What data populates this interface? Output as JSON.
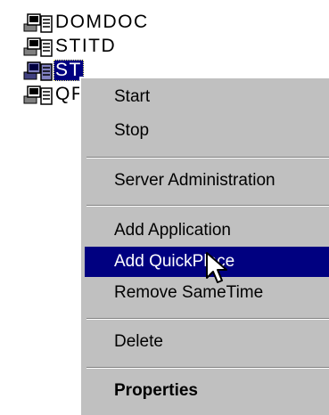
{
  "tree": {
    "items": [
      {
        "label": "DOMDOC",
        "selected": false
      },
      {
        "label": "STITD",
        "selected": false
      },
      {
        "label": "ST",
        "selected": true
      },
      {
        "label": "QF",
        "selected": false
      }
    ],
    "icon": "server-computer-icon"
  },
  "context_menu": {
    "items": {
      "start": {
        "label": "Start",
        "has_submenu": true
      },
      "stop": {
        "label": "Stop",
        "has_submenu": true
      },
      "server_admin": {
        "label": "Server Administration"
      },
      "add_application": {
        "label": "Add Application"
      },
      "add_quickplace": {
        "label": "Add QuickPlace",
        "highlighted": true
      },
      "remove_sametime": {
        "label": "Remove SameTime"
      },
      "delete": {
        "label": "Delete"
      },
      "properties": {
        "label": "Properties",
        "bold": true
      }
    }
  },
  "colors": {
    "highlight": "#000080",
    "menu_background": "#c0c0c0",
    "highlight_text": "#ffffff"
  },
  "cursor": {
    "icon": "arrow-pointer-icon"
  }
}
